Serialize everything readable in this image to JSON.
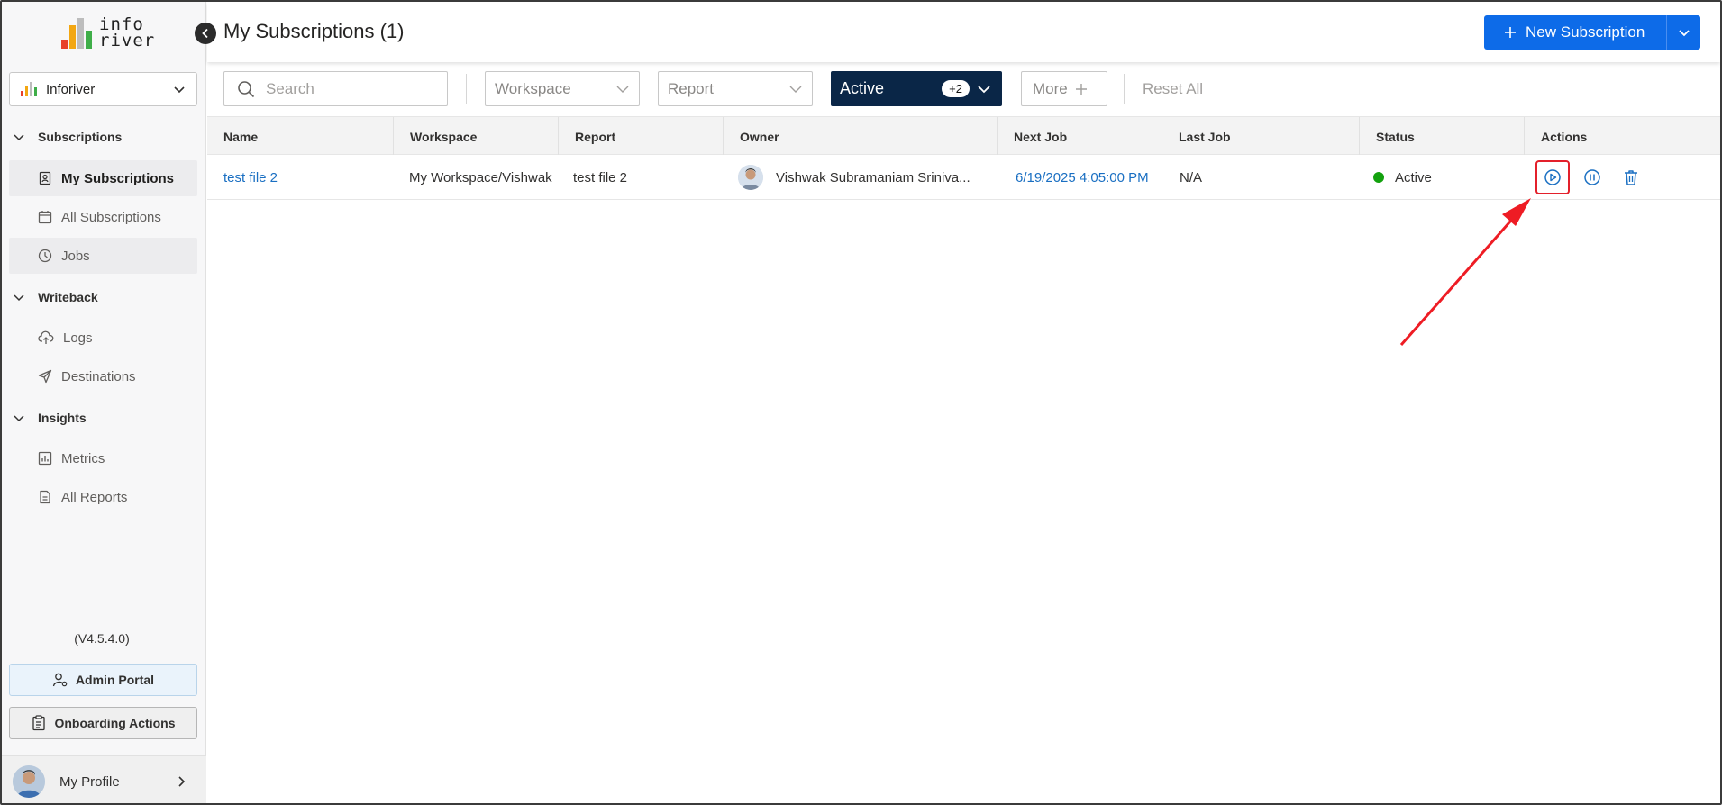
{
  "app": {
    "logo_text_line1": "info",
    "logo_text_line2": "river",
    "workspace_select": "Inforiver"
  },
  "sidebar": {
    "sections": [
      {
        "label": "Subscriptions"
      },
      {
        "label": "Writeback"
      },
      {
        "label": "Insights"
      }
    ],
    "items": [
      {
        "label": "My Subscriptions",
        "icon": "id-badge-icon"
      },
      {
        "label": "All Subscriptions",
        "icon": "calendar-icon"
      },
      {
        "label": "Jobs",
        "icon": "clock-icon"
      },
      {
        "label": "Logs",
        "icon": "cloud-upload-icon"
      },
      {
        "label": "Destinations",
        "icon": "send-icon"
      },
      {
        "label": "Metrics",
        "icon": "bar-chart-icon"
      },
      {
        "label": "All Reports",
        "icon": "document-icon"
      }
    ],
    "version": "(V4.5.4.0)",
    "admin_portal": "Admin Portal",
    "onboarding_actions": "Onboarding Actions",
    "profile_label": "My Profile"
  },
  "header": {
    "title": "My Subscriptions (1)",
    "new_subscription": "New Subscription"
  },
  "filters": {
    "search_placeholder": "Search",
    "workspace": "Workspace",
    "report": "Report",
    "status": "Active",
    "status_extra": "+2",
    "more": "More",
    "reset_all": "Reset All"
  },
  "table": {
    "columns": [
      "Name",
      "Workspace",
      "Report",
      "Owner",
      "Next Job",
      "Last Job",
      "Status",
      "Actions"
    ],
    "rows": [
      {
        "name": "test file 2",
        "workspace": "My Workspace/Vishwak",
        "report": "test file 2",
        "owner": "Vishwak Subramaniam Sriniva...",
        "next_job": "6/19/2025 4:05:00 PM",
        "last_job": "N/A",
        "status": "Active"
      }
    ]
  },
  "colors": {
    "primary": "#0d6be8",
    "status_filter_bg": "#0a2647",
    "active_dot": "#13a10e",
    "highlight": "#e3202b",
    "link": "#1a6fc2"
  }
}
